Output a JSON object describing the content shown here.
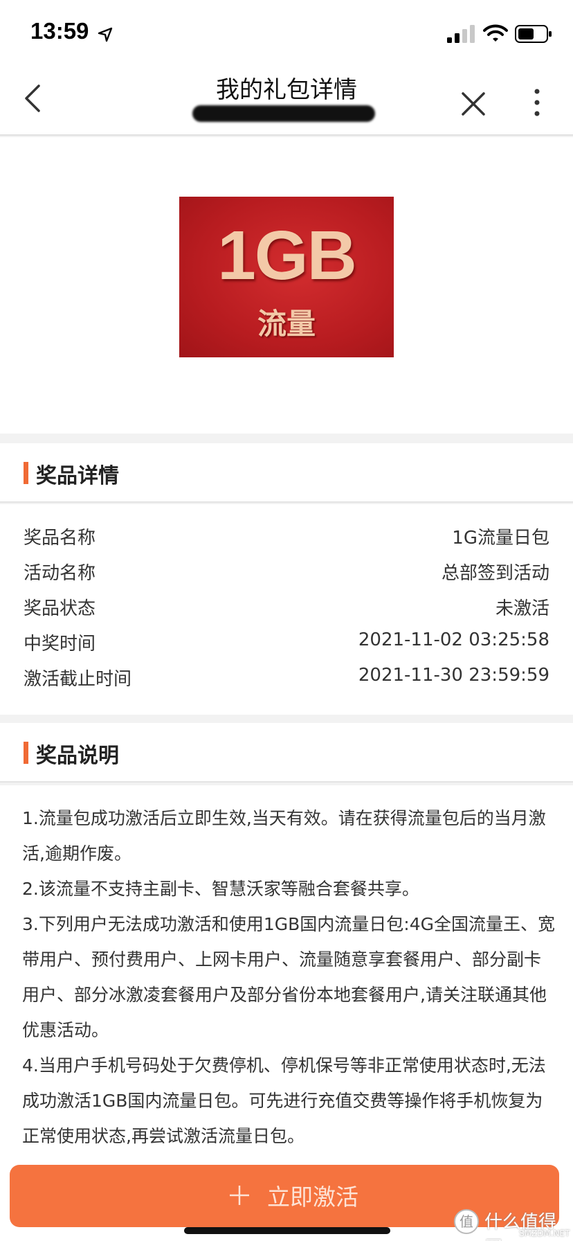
{
  "status_bar": {
    "time": "13:59"
  },
  "nav": {
    "title": "我的礼包详情",
    "subtitle": "",
    "icons": [
      "back-icon",
      "close-icon",
      "more-icon"
    ]
  },
  "banner": {
    "image_size_text": "1GB",
    "image_label_text": "流量"
  },
  "prize_details": {
    "title": "奖品详情",
    "rows": [
      {
        "label": "奖品名称",
        "value": "1G流量日包"
      },
      {
        "label": "活动名称",
        "value": "总部签到活动"
      },
      {
        "label": "奖品状态",
        "value": "未激活"
      },
      {
        "label": "中奖时间",
        "value": "2021-11-02 03:25:58"
      },
      {
        "label": "激活截止时间",
        "value": "2021-11-30 23:59:59"
      }
    ]
  },
  "prize_notes": {
    "title": "奖品说明",
    "paragraphs": [
      "1.流量包成功激活后立即生效,当天有效。请在获得流量包后的当月激活,逾期作废。",
      "2.该流量不支持主副卡、智慧沃家等融合套餐共享。",
      "3.下列用户无法成功激活和使用1GB国内流量日包:4G全国流量王、宽带用户、预付费用户、上网卡用户、流量随意享套餐用户、部分副卡用户、部分冰激凌套餐用户及部分省份本地套餐用户,请关注联通其他优惠活动。",
      "4.当用户手机号码处于欠费停机、停机保号等非正常使用状态时,无法成功激活1GB国内流量日包。可先进行充值交费等操作将手机恢复为正常使用状态,再尝试激活流量日包。"
    ]
  },
  "bottom": {
    "activate_label": "立即激活",
    "watermark_text": "什么值得买",
    "watermark_small": "SMZDM.NET",
    "watermark_badge": "值"
  },
  "colors": {
    "accent": "#f06a35",
    "button": "#f5733f",
    "banner_red": "#c62226"
  }
}
